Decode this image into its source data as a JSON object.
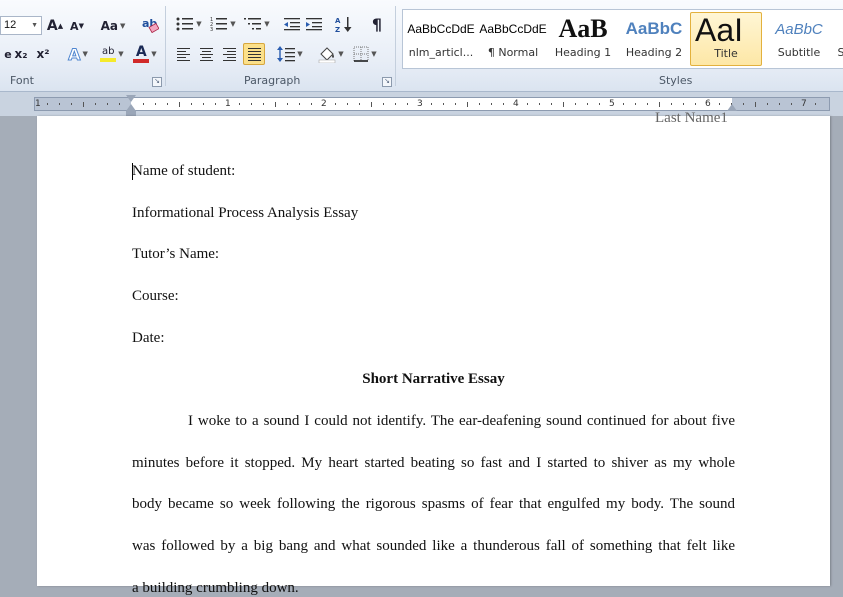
{
  "ribbon": {
    "font": {
      "size_value": "12",
      "group_label": "Font",
      "grow_label": "A",
      "shrink_label": "A",
      "case_label": "Aa",
      "subscript_label": "x₂",
      "superscript_label": "x²",
      "effects_label": "A",
      "highlight_label": "ab",
      "color_label": "A",
      "highlight_color": "#f5ea2b",
      "font_color": "#d12a2a"
    },
    "paragraph": {
      "group_label": "Paragraph",
      "show_marks_label": "¶"
    },
    "styles": {
      "group_label": "Styles",
      "items": [
        {
          "preview": "AaBbCcDdE",
          "name": "nlm_articl..."
        },
        {
          "preview": "AaBbCcDdE",
          "name": "¶ Normal"
        },
        {
          "preview": "AaB",
          "name": "Heading 1"
        },
        {
          "preview": "AaBbC",
          "name": "Heading 2"
        },
        {
          "preview": "AaI",
          "name": "Title"
        },
        {
          "preview": "AaBbC",
          "name": "Subtitle"
        },
        {
          "preview": "",
          "name": "S"
        }
      ],
      "heading_color": "#1f4e9c",
      "subtitle_color": "#4f81bd"
    }
  },
  "ruler": {
    "numbers": [
      "1",
      "1",
      "2",
      "3",
      "4",
      "5",
      "6",
      "7"
    ]
  },
  "document": {
    "header": "Last Name1",
    "lines": {
      "name_of_student": "Name of student:",
      "essay_type": "Informational Process Analysis Essay",
      "tutor": "Tutor’s Name:",
      "course": "Course:",
      "date": "Date:"
    },
    "title": "Short Narrative Essay",
    "body": [
      "I woke to a sound I could not identify. The ear-deafening sound continued for about five",
      "minutes before it stopped. My heart started beating so fast and I started to shiver as my whole",
      "body became so week following the rigorous spasms of fear that engulfed my body. The sound",
      "was followed by a big bang and what sounded like a thunderous fall of something that felt like",
      "a building crumbling down."
    ]
  }
}
